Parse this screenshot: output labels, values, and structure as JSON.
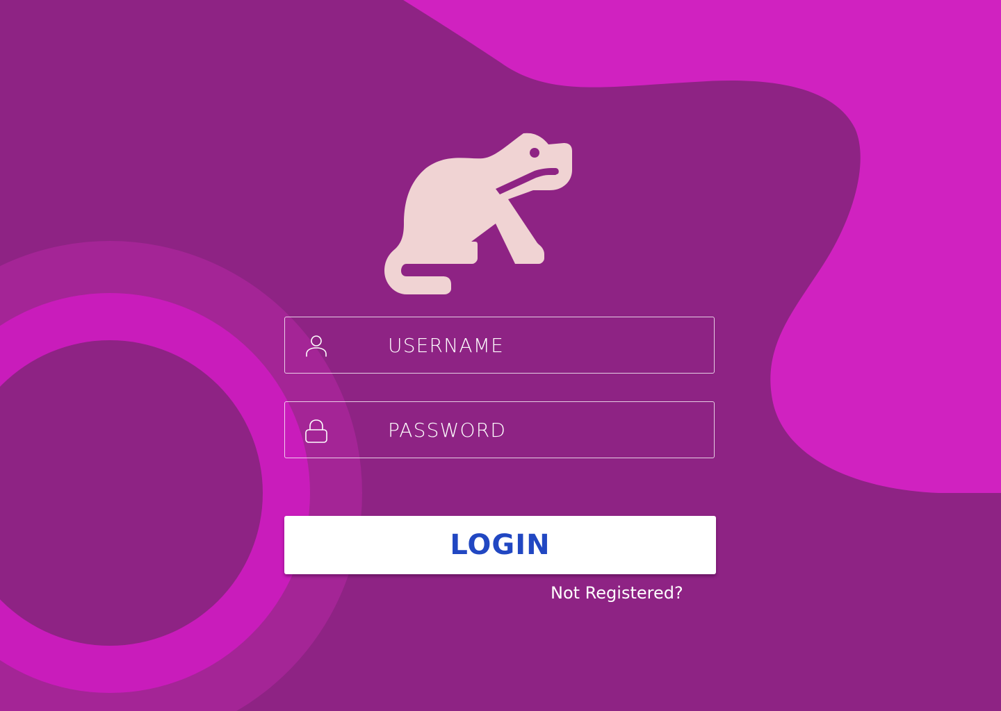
{
  "colors": {
    "background": "#8e2384",
    "blob_magenta": "#d022c0",
    "ring_outer": "#a42596",
    "ring_inner": "#c91cbb",
    "logo": "#f0d3d3",
    "field_border": "#ffffff",
    "button_bg": "#ffffff",
    "button_text": "#2147c2"
  },
  "logo": {
    "icon": "frog-icon"
  },
  "form": {
    "username": {
      "icon": "user-icon",
      "placeholder": "USERNAME",
      "value": ""
    },
    "password": {
      "icon": "lock-icon",
      "placeholder": "PASSWORD",
      "value": ""
    },
    "login_label": "LOGIN",
    "register_link": "Not Registered?"
  }
}
